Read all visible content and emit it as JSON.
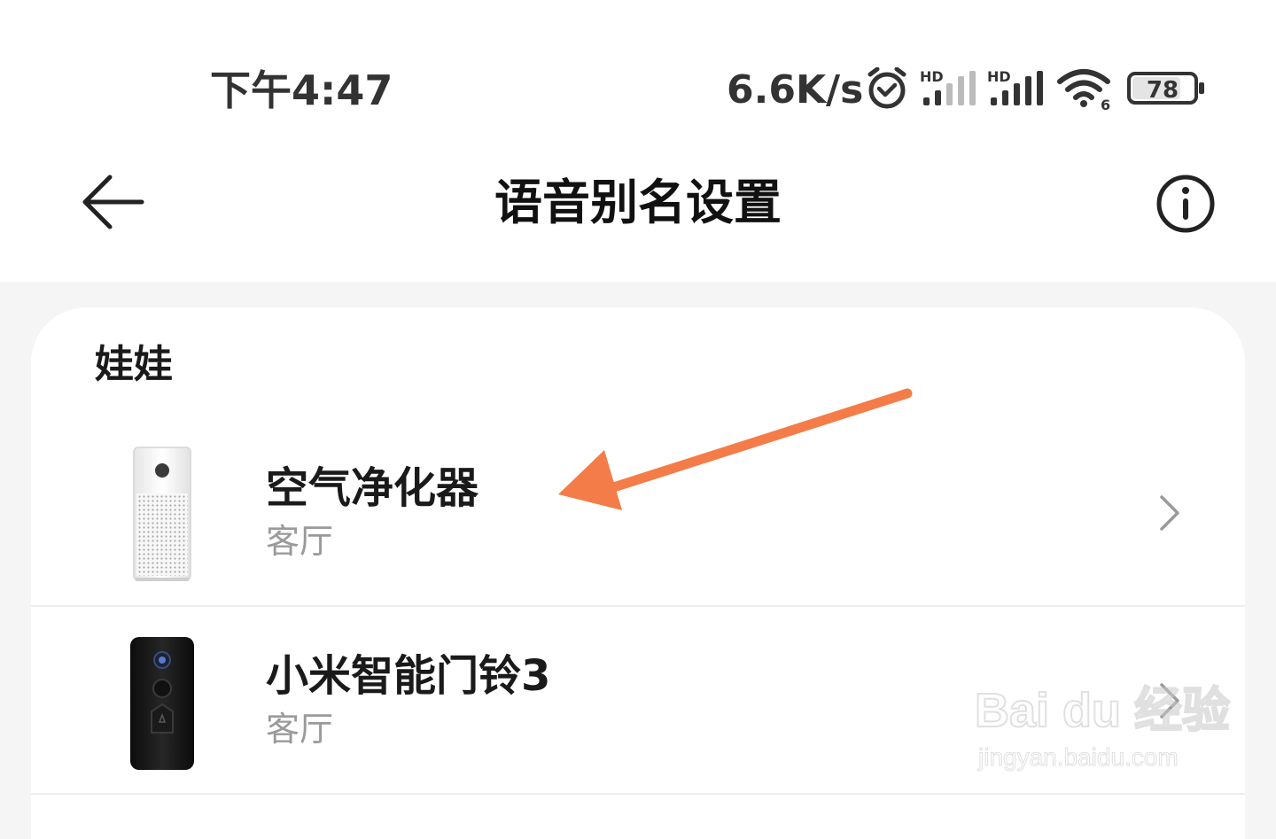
{
  "status_bar": {
    "time": "下午4:47",
    "net_speed": "6.6K/s",
    "battery": "78",
    "icons": [
      "alarm-icon",
      "hd-signal-icon",
      "hd-signal-icon",
      "wifi-icon",
      "battery-icon"
    ],
    "signal_label": "HD",
    "wifi_label": "6"
  },
  "header": {
    "title": "语音别名设置",
    "back_icon": "back-arrow-icon",
    "info_icon": "info-icon"
  },
  "group": {
    "name": "娃娃",
    "devices": [
      {
        "name": "空气净化器",
        "room": "客厅",
        "icon": "air-purifier-image"
      },
      {
        "name": "小米智能门铃3",
        "room": "客厅",
        "icon": "doorbell-image"
      }
    ]
  },
  "annotation": {
    "color": "#f47c48"
  },
  "watermark": {
    "brand": "Bai du 经验",
    "url": "jingyan.baidu.com"
  }
}
